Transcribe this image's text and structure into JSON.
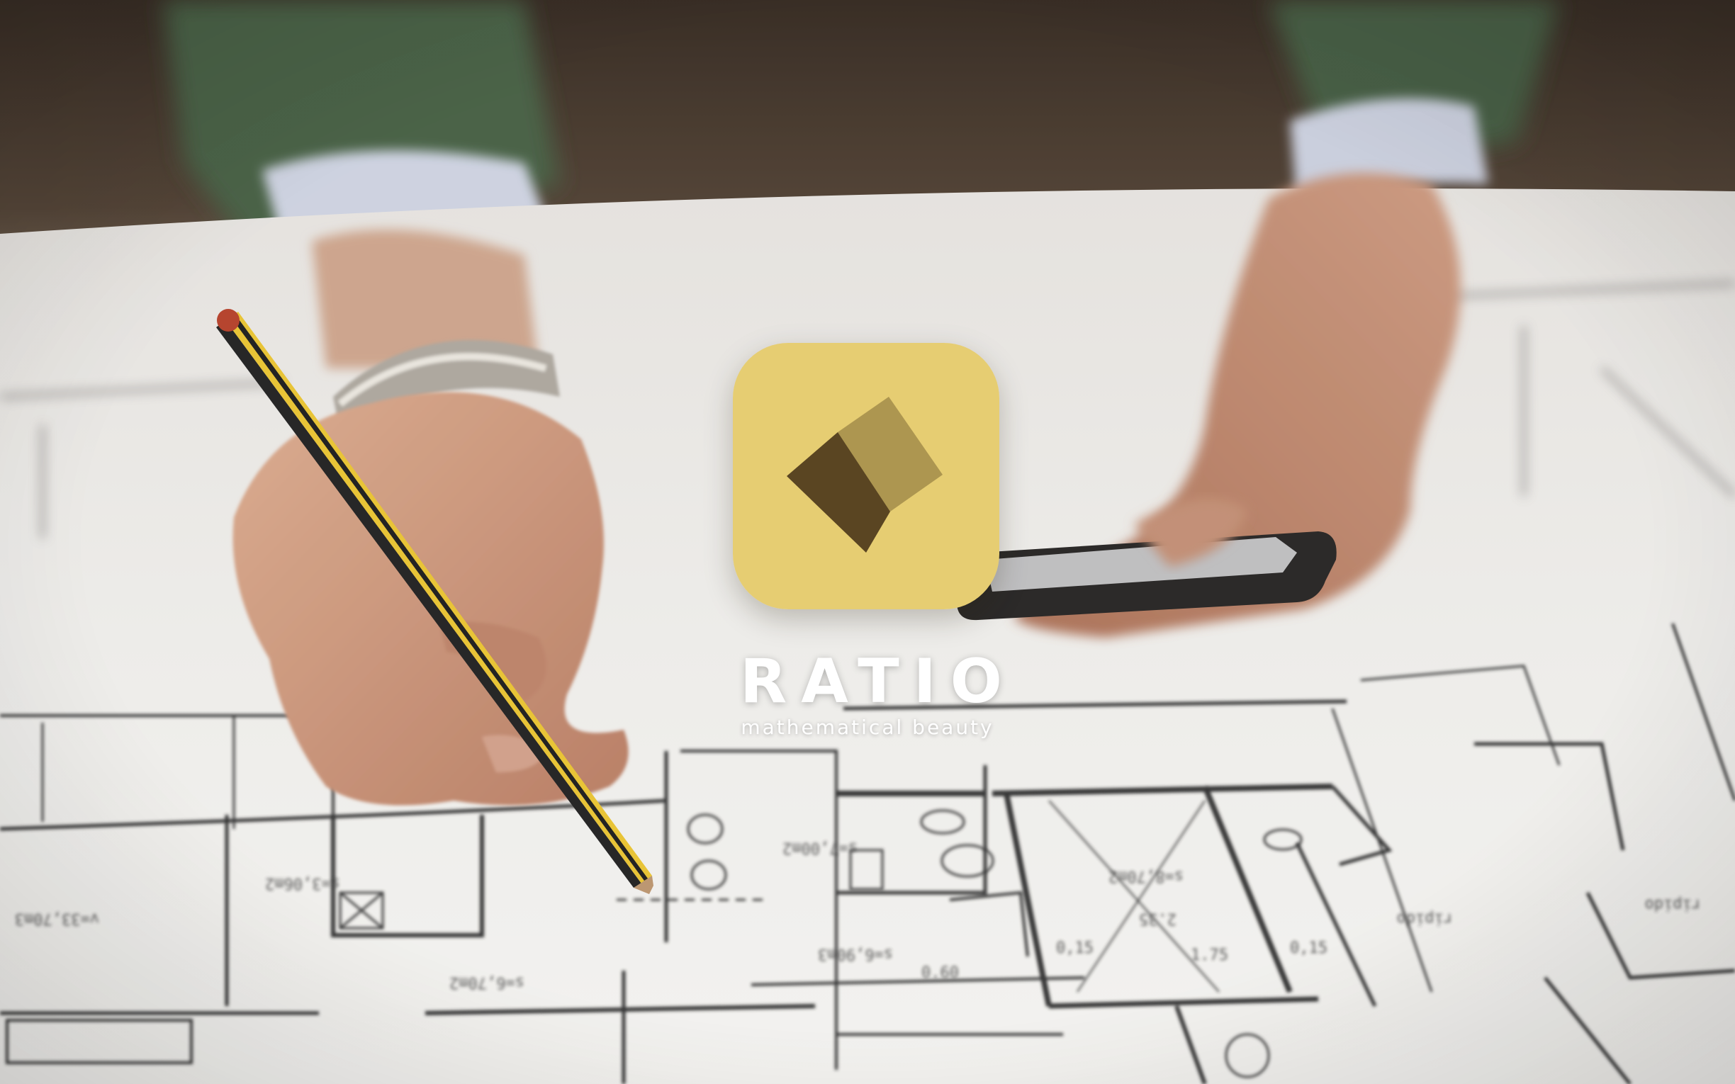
{
  "brand": {
    "name": "RATIO",
    "tagline": "mathematical beauty",
    "icon": "diamond-logo-icon",
    "colors": {
      "icon_background": "#e6cd72",
      "diamond_light": "#ad9650",
      "diamond_dark": "#5a4522",
      "text": "#ffffff"
    }
  },
  "photo": {
    "subject_icons": [
      "hand-icon",
      "pencil-icon",
      "smartphone-icon",
      "blueprint-icon",
      "watch-icon"
    ]
  }
}
